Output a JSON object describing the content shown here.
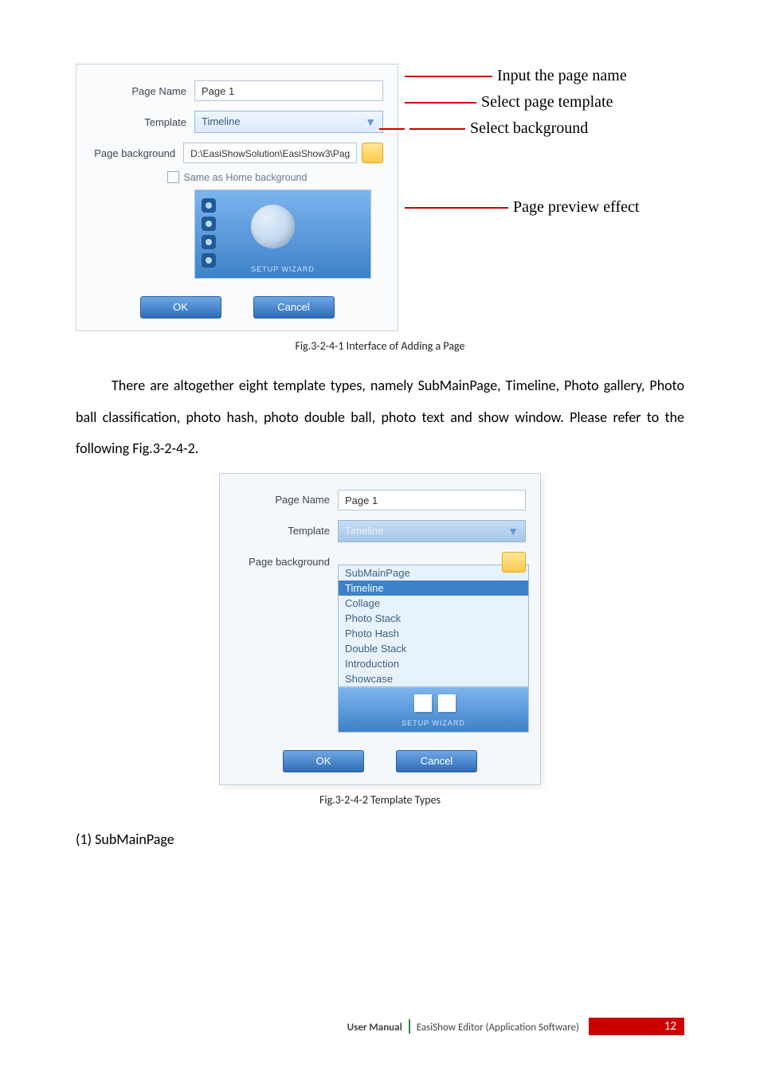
{
  "figure1": {
    "dialog": {
      "pageNameLabel": "Page Name",
      "pageNameValue": "Page 1",
      "templateLabel": "Template",
      "templateValue": "Timeline",
      "bgLabel": "Page background",
      "bgValue": "D:\\EasiShowSolution\\EasiShow3\\Pag",
      "sameAsHome": "Same as Home background",
      "watermark": "SETUP WIZARD",
      "okLabel": "OK",
      "cancelLabel": "Cancel"
    },
    "annotations": {
      "inputName": "Input the page name",
      "selectTemplate": "Select page template",
      "selectBg": "Select background",
      "previewEffect": "Page preview effect"
    },
    "caption": "Fig.3-2-4-1 Interface of Adding a Page"
  },
  "paragraph": "There are altogether eight template types, namely SubMainPage, Timeline, Photo gallery, Photo ball classification, photo hash, photo double ball, photo text and show window. Please refer to the following Fig.3-2-4-2.",
  "figure2": {
    "dialog": {
      "pageNameLabel": "Page Name",
      "pageNameValue": "Page 1",
      "templateLabel": "Template",
      "templateValue": "Timeline",
      "bgLabel": "Page background",
      "options": [
        "SubMainPage",
        "Timeline",
        "Collage",
        "Photo Stack",
        "Photo Hash",
        "Double Stack",
        "Introduction",
        "Showcase"
      ],
      "selectedIndex": 1,
      "watermark": "SETUP WIZARD",
      "okLabel": "OK",
      "cancelLabel": "Cancel"
    },
    "caption": "Fig.3-2-4-2 Template Types"
  },
  "listItem": "(1) SubMainPage",
  "footer": {
    "left": "User Manual",
    "right": "EasiShow Editor (Application Software)",
    "pageNum": "12"
  }
}
